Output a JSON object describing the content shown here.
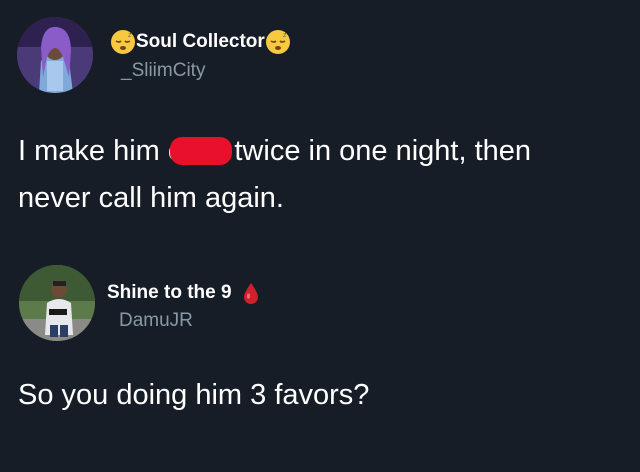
{
  "tweets": [
    {
      "display_name": "Soul Collector",
      "handle": "_SliimCity",
      "emoji_before": "sleeping-face-emoji",
      "emoji_after": "sleeping-face-emoji",
      "text_part1": "I make him c",
      "text_part2": "twice in one night, then",
      "text_line2": "never call him again."
    },
    {
      "display_name": "Shine to the 9",
      "handle": "DamuJR",
      "badge": "red-drop-emoji",
      "text": "So you doing him 3 favors?"
    }
  ],
  "colors": {
    "background": "#171d27",
    "text": "#ffffff",
    "handle": "#8899a6",
    "redaction": "#e8102a"
  }
}
